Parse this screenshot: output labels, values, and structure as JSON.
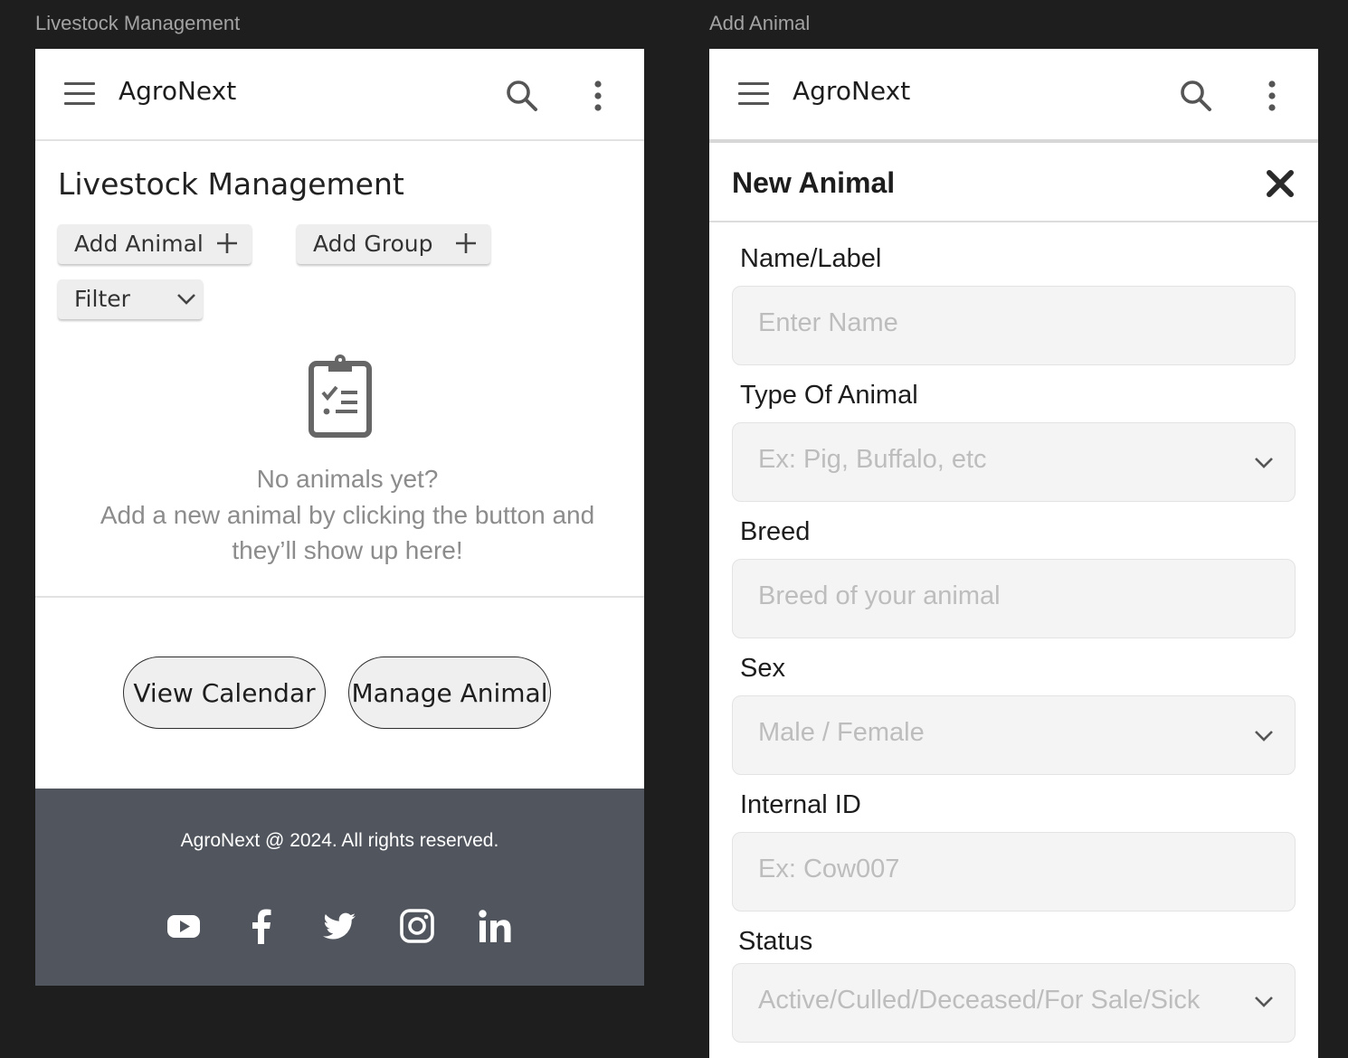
{
  "canvas": {
    "left_frame_label": "Livestock Management",
    "right_frame_label": "Add Animal"
  },
  "appbar": {
    "brand": "AgroNext",
    "menu_icon": "hamburger-menu-icon",
    "search_icon": "search-icon",
    "more_icon": "more-vertical-icon"
  },
  "livestock": {
    "title": "Livestock Management",
    "add_animal_label": "Add Animal",
    "add_group_label": "Add Group",
    "filter_label": "Filter",
    "empty_icon": "clipboard-checklist-icon",
    "empty_line1": "No animals yet?",
    "empty_line2": "Add a new animal by clicking the button and",
    "empty_line3": "they’ll show up here!",
    "view_calendar_label": "View Calendar",
    "manage_animal_label": "Manage Animal"
  },
  "footer": {
    "copyright": "AgroNext @ 2024. All rights reserved.",
    "social": [
      "youtube-icon",
      "facebook-icon",
      "twitter-icon",
      "instagram-icon",
      "linkedin-icon"
    ],
    "background": "#51565e"
  },
  "add_animal": {
    "title": "New Animal",
    "close_icon": "close-icon",
    "fields": [
      {
        "label": "Name/Label",
        "placeholder": "Enter Name",
        "type": "text"
      },
      {
        "label": "Type Of Animal",
        "placeholder": "Ex: Pig, Buffalo, etc",
        "type": "select"
      },
      {
        "label": "Breed",
        "placeholder": "Breed of your animal",
        "type": "text"
      },
      {
        "label": "Sex",
        "placeholder": "Male / Female",
        "type": "select"
      },
      {
        "label": "Internal ID",
        "placeholder": "Ex: Cow007",
        "type": "text"
      },
      {
        "label": "Status",
        "placeholder": "Active/Culled/Deceased/For Sale/Sick",
        "type": "select"
      }
    ]
  },
  "colors": {
    "canvas_bg": "#1e1e1e",
    "chip_bg": "#eeeeee",
    "field_bg": "#f4f4f4",
    "placeholder": "#bdbdbd"
  }
}
